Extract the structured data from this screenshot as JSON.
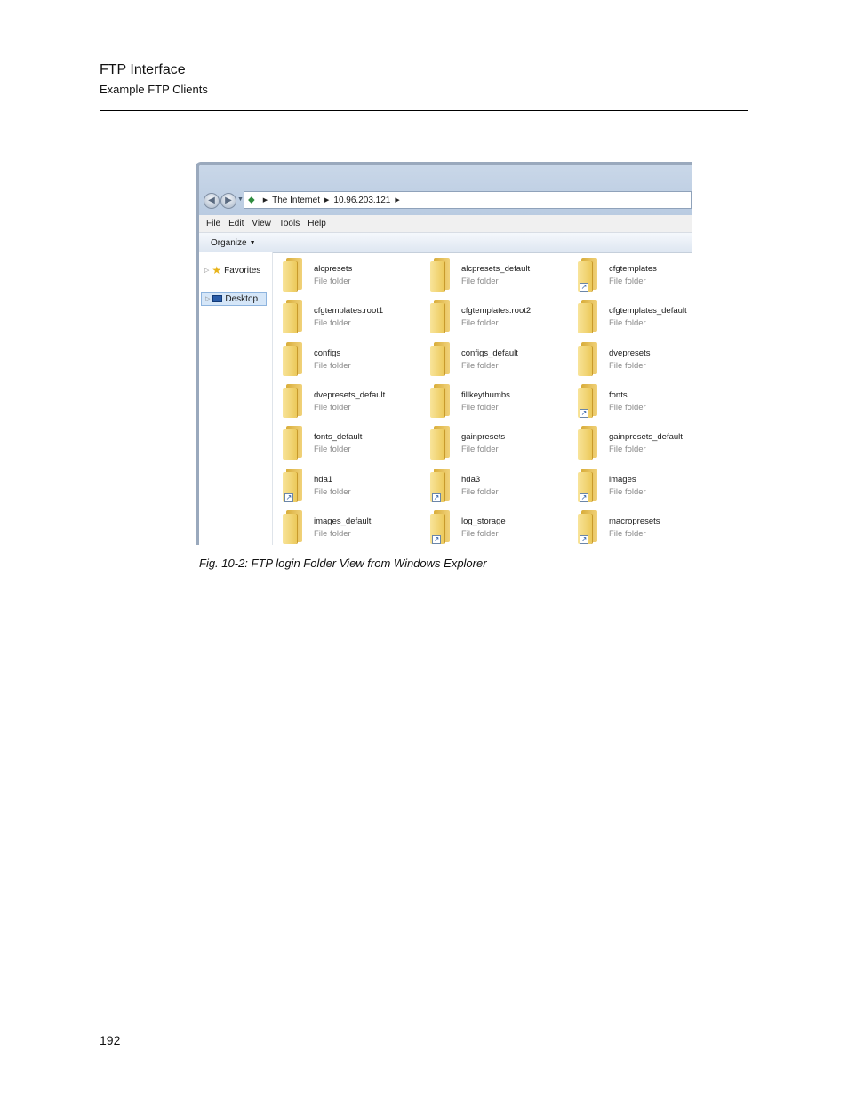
{
  "header": {
    "title": "FTP Interface",
    "subtitle": "Example FTP Clients"
  },
  "figure": {
    "caption": "Fig. 10-2: FTP login Folder View from Windows Explorer"
  },
  "page_number": "192",
  "explorer": {
    "breadcrumb": [
      "The Internet",
      "10.96.203.121"
    ],
    "menu": [
      "File",
      "Edit",
      "View",
      "Tools",
      "Help"
    ],
    "organize_label": "Organize",
    "nav_items": [
      "Favorites",
      "Desktop"
    ],
    "items": [
      {
        "name": "alcpresets",
        "type": "File folder",
        "shortcut": false
      },
      {
        "name": "alcpresets_default",
        "type": "File folder",
        "shortcut": false
      },
      {
        "name": "cfgtemplates",
        "type": "File folder",
        "shortcut": true
      },
      {
        "name": "cfgtemplates.root1",
        "type": "File folder",
        "shortcut": false
      },
      {
        "name": "cfgtemplates.root2",
        "type": "File folder",
        "shortcut": false
      },
      {
        "name": "cfgtemplates_default",
        "type": "File folder",
        "shortcut": false
      },
      {
        "name": "configs",
        "type": "File folder",
        "shortcut": false
      },
      {
        "name": "configs_default",
        "type": "File folder",
        "shortcut": false
      },
      {
        "name": "dvepresets",
        "type": "File folder",
        "shortcut": false
      },
      {
        "name": "dvepresets_default",
        "type": "File folder",
        "shortcut": false
      },
      {
        "name": "fillkeythumbs",
        "type": "File folder",
        "shortcut": false
      },
      {
        "name": "fonts",
        "type": "File folder",
        "shortcut": true
      },
      {
        "name": "fonts_default",
        "type": "File folder",
        "shortcut": false
      },
      {
        "name": "gainpresets",
        "type": "File folder",
        "shortcut": false
      },
      {
        "name": "gainpresets_default",
        "type": "File folder",
        "shortcut": false
      },
      {
        "name": "hda1",
        "type": "File folder",
        "shortcut": true
      },
      {
        "name": "hda3",
        "type": "File folder",
        "shortcut": true
      },
      {
        "name": "images",
        "type": "File folder",
        "shortcut": true
      },
      {
        "name": "images_default",
        "type": "File folder",
        "shortcut": false
      },
      {
        "name": "log_storage",
        "type": "File folder",
        "shortcut": true
      },
      {
        "name": "macropresets",
        "type": "File folder",
        "shortcut": true
      }
    ]
  }
}
